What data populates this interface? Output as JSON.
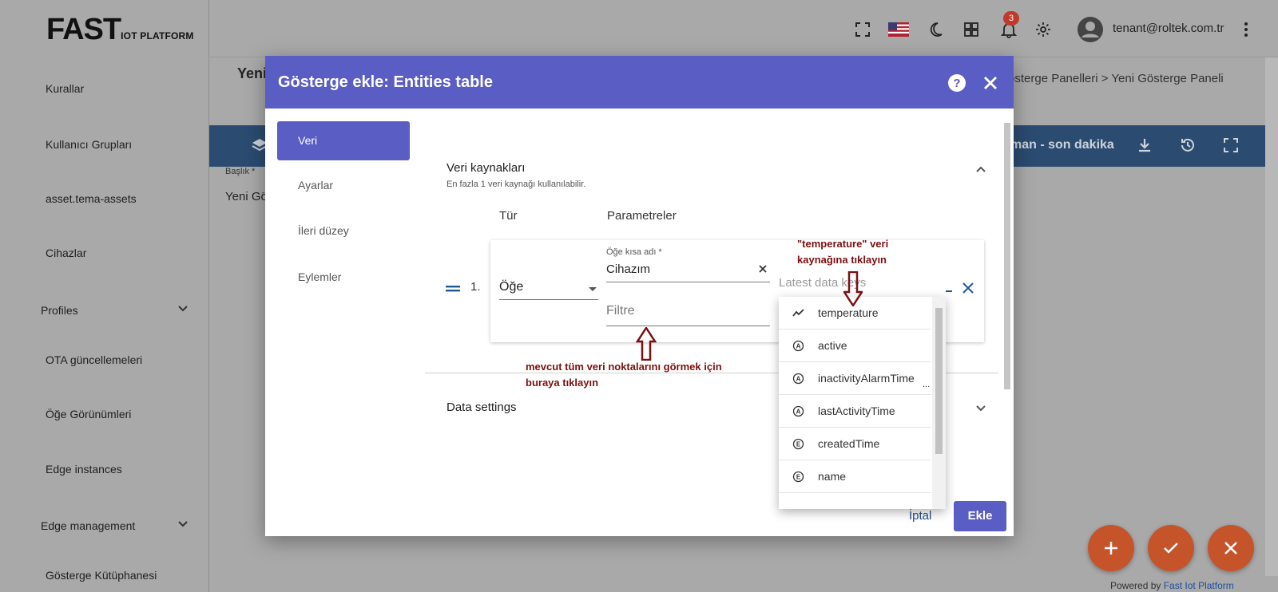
{
  "app": {
    "logo_main": "FAST",
    "logo_sub": "IOT PLATFORM",
    "user_email": "tenant@roltek.com.tr",
    "notification_count": "3",
    "powered_prefix": "Powered by",
    "powered_brand": "Fast Iot Platform"
  },
  "sidebar": {
    "items": [
      {
        "label": "Kurallar"
      },
      {
        "label": "Kullanıcı Grupları"
      },
      {
        "label": "asset.tema-assets"
      },
      {
        "label": "Cihazlar"
      },
      {
        "label": "Profiles"
      },
      {
        "label": "OTA güncellemeleri"
      },
      {
        "label": "Öğe Görünümleri"
      },
      {
        "label": "Edge instances"
      },
      {
        "label": "Edge management"
      },
      {
        "label": "Gösterge Kütüphanesi"
      }
    ]
  },
  "page": {
    "title": "Yeni",
    "breadcrumb": "österge Panelleri  >  Yeni Gösterge Paneli",
    "toolbar_time": "man - son dakika",
    "baslik_label": "Başlık *",
    "baslik_value": "Yeni Gö"
  },
  "dialog": {
    "title": "Gösterge ekle: Entities table",
    "tabs": [
      {
        "label": "Veri"
      },
      {
        "label": "Ayarlar"
      },
      {
        "label": "İleri düzey"
      },
      {
        "label": "Eylemler"
      }
    ],
    "section_title": "Veri kaynakları",
    "section_sub": "En fazla 1 veri kaynağı kullanılabilir.",
    "col_type": "Tür",
    "col_params": "Parametreler",
    "row_number": "1.",
    "type_value": "Öğe",
    "entity_label": "Öğe kısa adı *",
    "entity_value": "Cihazım",
    "filter_placeholder": "Filtre",
    "latest_keys_placeholder": "Latest data keys",
    "data_settings": "Data settings",
    "cancel": "İptal",
    "add": "Ekle"
  },
  "dropdown": {
    "items": [
      {
        "label": "temperature",
        "icon": "timeseries-icon"
      },
      {
        "label": "active",
        "icon": "attribute-icon"
      },
      {
        "label": "inactivityAlarmTime",
        "icon": "attribute-icon"
      },
      {
        "label": "lastActivityTime",
        "icon": "attribute-icon"
      },
      {
        "label": "createdTime",
        "icon": "entity-field-icon"
      },
      {
        "label": "name",
        "icon": "entity-field-icon"
      }
    ]
  },
  "annotations": {
    "top_line1": "\"temperature\" veri",
    "top_line2": "kaynağına tıklayın",
    "bottom_line1": "mevcut tüm veri noktalarını görmek için",
    "bottom_line2": "buraya tıklayın"
  },
  "colors": {
    "primary": "#5a5dc4",
    "toolbar": "#2c4b71",
    "fab": "#c6542b",
    "annotation": "#7a1010"
  }
}
